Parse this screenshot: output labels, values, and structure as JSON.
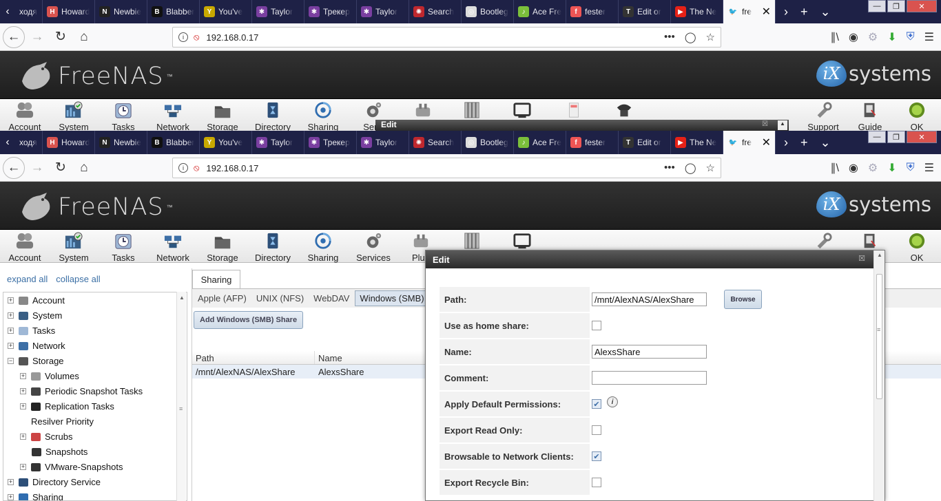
{
  "browser": {
    "tabs": [
      {
        "title": "ходя",
        "color": "#1e2146",
        "glyph": "‹"
      },
      {
        "title": "Howard",
        "color": "#d9534f",
        "glyph": "H"
      },
      {
        "title": "Newbie",
        "color": "#222",
        "glyph": "N"
      },
      {
        "title": "Blabber",
        "color": "#111",
        "glyph": "B"
      },
      {
        "title": "You've",
        "color": "#c8a800",
        "glyph": "Y"
      },
      {
        "title": "Taylor",
        "color": "#7a3fa0",
        "glyph": "✱"
      },
      {
        "title": "Трекер",
        "color": "#7a3fa0",
        "glyph": "✱"
      },
      {
        "title": "Taylor",
        "color": "#7a3fa0",
        "glyph": "✱"
      },
      {
        "title": "Search",
        "color": "#c0282e",
        "glyph": "✺"
      },
      {
        "title": "Bootleg",
        "color": "#ddd",
        "glyph": "◎"
      },
      {
        "title": "Ace Fre",
        "color": "#7bbf3b",
        "glyph": "♪"
      },
      {
        "title": "fester",
        "color": "#e55",
        "glyph": "f"
      },
      {
        "title": "Edit or",
        "color": "#333",
        "glyph": "T"
      },
      {
        "title": "The Ne",
        "color": "#e62117",
        "glyph": "▶"
      },
      {
        "title": "fre",
        "color": "#f9f9fa",
        "glyph": "🐦"
      }
    ],
    "active_tab_close": "✕",
    "new_tab": "+",
    "tab_list": "⌄",
    "scroll_right": "›",
    "win_minimize": "—",
    "win_maximize": "❐",
    "win_close": "✕",
    "url": "192.168.0.17",
    "url_more": "•••",
    "icons": {
      "back": "back-arrow-icon",
      "forward": "forward-arrow-icon",
      "reload": "reload-icon",
      "home": "home-icon",
      "library": "library-icon",
      "menu": "hamburger-menu-icon"
    }
  },
  "freenas": {
    "brand": "FreeNAS",
    "tm": "™",
    "vendor_ix": "iX",
    "vendor_systems": "systems",
    "toolbar_top": [
      {
        "label": "Account",
        "icon": "account-icon"
      },
      {
        "label": "System",
        "icon": "system-icon"
      },
      {
        "label": "Tasks",
        "icon": "tasks-icon"
      },
      {
        "label": "Network",
        "icon": "network-icon"
      },
      {
        "label": "Storage",
        "icon": "storage-icon"
      },
      {
        "label": "Directory",
        "icon": "directory-icon"
      },
      {
        "label": "Sharing",
        "icon": "sharing-icon"
      },
      {
        "label": "Servi",
        "icon": "services-icon"
      },
      {
        "label": "Support",
        "icon": "support-icon"
      },
      {
        "label": "Guide",
        "icon": "guide-icon"
      },
      {
        "label": "OK",
        "icon": "alert-ok-icon"
      }
    ],
    "ghost_dialog_title": "Edit",
    "toolbar": [
      {
        "label": "Account",
        "icon": "account-icon"
      },
      {
        "label": "System",
        "icon": "system-icon"
      },
      {
        "label": "Tasks",
        "icon": "tasks-icon"
      },
      {
        "label": "Network",
        "icon": "network-icon"
      },
      {
        "label": "Storage",
        "icon": "storage-icon"
      },
      {
        "label": "Directory",
        "icon": "directory-icon"
      },
      {
        "label": "Sharing",
        "icon": "sharing-icon"
      },
      {
        "label": "Services",
        "icon": "services-icon"
      },
      {
        "label": "Plug",
        "icon": "plugins-icon"
      },
      {
        "label": "OK",
        "icon": "alert-ok-icon"
      }
    ],
    "tree_links": {
      "expand": "expand all",
      "collapse": "collapse all"
    },
    "tree": [
      {
        "label": "Account",
        "indent": 0,
        "exp": "+",
        "icon": "account-icon"
      },
      {
        "label": "System",
        "indent": 0,
        "exp": "+",
        "icon": "system-icon"
      },
      {
        "label": "Tasks",
        "indent": 0,
        "exp": "+",
        "icon": "tasks-icon"
      },
      {
        "label": "Network",
        "indent": 0,
        "exp": "+",
        "icon": "network-icon"
      },
      {
        "label": "Storage",
        "indent": 0,
        "exp": "−",
        "icon": "storage-icon"
      },
      {
        "label": "Volumes",
        "indent": 1,
        "exp": "+",
        "icon": "volumes-icon"
      },
      {
        "label": "Periodic Snapshot Tasks",
        "indent": 1,
        "exp": "+",
        "icon": "snapshot-tasks-icon"
      },
      {
        "label": "Replication Tasks",
        "indent": 1,
        "exp": "+",
        "icon": "replication-icon"
      },
      {
        "label": "Resilver Priority",
        "indent": 2,
        "exp": "",
        "icon": ""
      },
      {
        "label": "Scrubs",
        "indent": 1,
        "exp": "+",
        "icon": "scrubs-icon"
      },
      {
        "label": "Snapshots",
        "indent": 2,
        "exp": "",
        "icon": "snapshots-icon"
      },
      {
        "label": "VMware-Snapshots",
        "indent": 1,
        "exp": "+",
        "icon": "vmware-icon"
      },
      {
        "label": "Directory Service",
        "indent": 0,
        "exp": "+",
        "icon": "directory-icon"
      },
      {
        "label": "Sharing",
        "indent": 0,
        "exp": "+",
        "icon": "sharing-icon"
      }
    ],
    "main": {
      "tab": "Sharing",
      "protocols": [
        "Apple (AFP)",
        "UNIX (NFS)",
        "WebDAV",
        "Windows (SMB)",
        "Blo"
      ],
      "selected_protocol": "Windows (SMB)",
      "add_button": "Add Windows (SMB) Share",
      "columns": [
        "Path",
        "Name"
      ],
      "rows": [
        {
          "path": "/mnt/AlexNAS/AlexShare",
          "name": "AlexsShare"
        }
      ]
    },
    "dialog": {
      "title": "Edit",
      "close": "☒",
      "browse": "Browse",
      "fields": [
        {
          "label": "Path:",
          "type": "text",
          "value": "/mnt/AlexNAS/AlexShare"
        },
        {
          "label": "Use as home share:",
          "type": "checkbox",
          "checked": false
        },
        {
          "label": "Name:",
          "type": "text",
          "value": "AlexsShare"
        },
        {
          "label": "Comment:",
          "type": "text",
          "value": ""
        },
        {
          "label": "Apply Default Permissions:",
          "type": "checkbox",
          "checked": true,
          "info": "i"
        },
        {
          "label": "Export Read Only:",
          "type": "checkbox",
          "checked": false
        },
        {
          "label": "Browsable to Network Clients:",
          "type": "checkbox",
          "checked": true
        },
        {
          "label": "Export Recycle Bin:",
          "type": "checkbox",
          "checked": false
        }
      ]
    }
  }
}
